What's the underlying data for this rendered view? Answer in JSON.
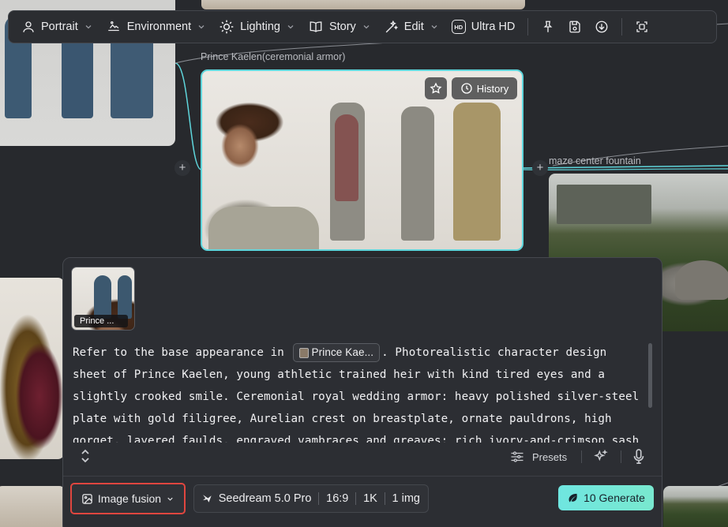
{
  "toolbar": {
    "items": [
      {
        "label": "Portrait",
        "icon": "user-icon"
      },
      {
        "label": "Environment",
        "icon": "landscape-icon"
      },
      {
        "label": "Lighting",
        "icon": "sun-icon"
      },
      {
        "label": "Story",
        "icon": "book-icon"
      },
      {
        "label": "Edit",
        "icon": "magic-wand-icon"
      }
    ],
    "ultra_hd_label": "Ultra HD",
    "hd_badge": "HD"
  },
  "nodes": {
    "main_label": "Prince Kaelen(ceremonial armor)",
    "maze_label": "maze center fountain"
  },
  "overlay": {
    "history_label": "History"
  },
  "panel": {
    "ref_thumb_caption": "Prince ...",
    "prompt_before_chip": "Refer to the base appearance in ",
    "chip_label": "Prince Kae...",
    "prompt_after_chip": ". Photorealistic character design sheet of Prince Kaelen, young athletic trained heir with kind tired eyes and a slightly crooked smile. Ceremonial royal wedding armor: heavy polished silver-steel plate with gold filigree, Aurelian crest on breastplate, ornate pauldrons, high gorget, layered faulds, engraved vambraces and greaves; rich ivory-and-crimson sash and short cape, ceremonial sword at hip. Formal imposing",
    "presets_label": "Presets"
  },
  "bottom": {
    "mode_label": "Image fusion",
    "model_label": "Seedream 5.0 Pro",
    "aspect": "16:9",
    "resolution": "1K",
    "count": "1 img",
    "generate_label": "10 Generate"
  },
  "colors": {
    "accent_cyan": "#5fd6dc",
    "highlight_red": "#e0463f",
    "generate_gradient_start": "#6fe6e0"
  }
}
